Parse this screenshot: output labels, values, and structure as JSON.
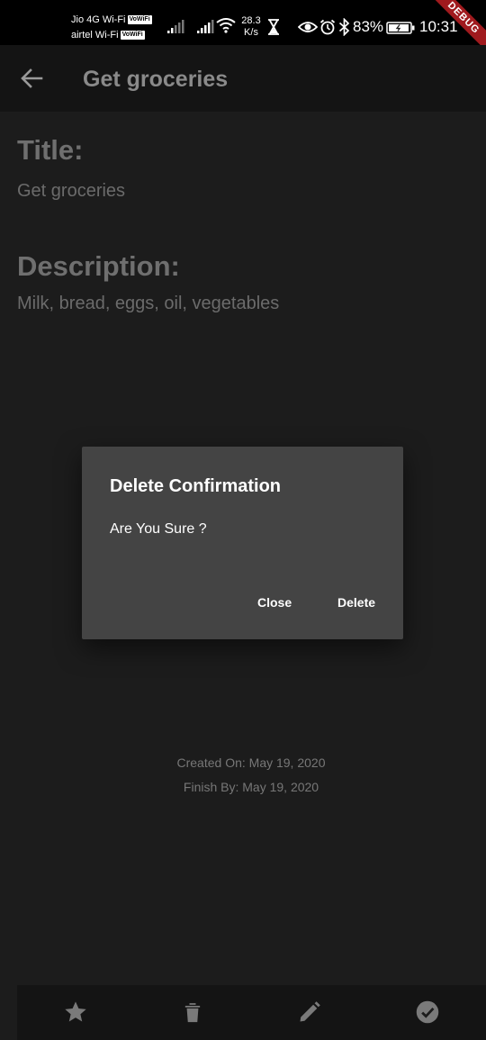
{
  "status_bar": {
    "carrier1": "Jio 4G Wi-Fi",
    "carrier2": "airtel Wi-Fi",
    "volte_badge": "VoWiFi",
    "net_speed_value": "28.3",
    "net_speed_unit": "K/s",
    "battery": "83%",
    "time": "10:31",
    "icons": [
      "signal-icon",
      "signal-icon",
      "wifi-icon",
      "hourglass-icon",
      "eye-icon",
      "alarm-icon",
      "bluetooth-icon",
      "battery-icon"
    ]
  },
  "debug_banner": "DEBUG",
  "appbar": {
    "title": "Get groceries",
    "back_icon": "arrow-back-icon"
  },
  "detail": {
    "title_label": "Title:",
    "title_value": "Get groceries",
    "description_label": "Description:",
    "description_value": "Milk, bread, eggs, oil, vegetables",
    "created_on": "Created On: May 19, 2020",
    "finish_by": "Finish By: May 19, 2020"
  },
  "dialog": {
    "title": "Delete Confirmation",
    "message": "Are You Sure ?",
    "close_label": "Close",
    "delete_label": "Delete"
  },
  "bottom_bar": {
    "icons": [
      "star-icon",
      "trash-icon",
      "pencil-icon",
      "check-circle-icon"
    ]
  },
  "colors": {
    "background": "#1c1c1c",
    "appbar": "#141414",
    "dialog": "#444444",
    "debug": "#a01a1e"
  }
}
